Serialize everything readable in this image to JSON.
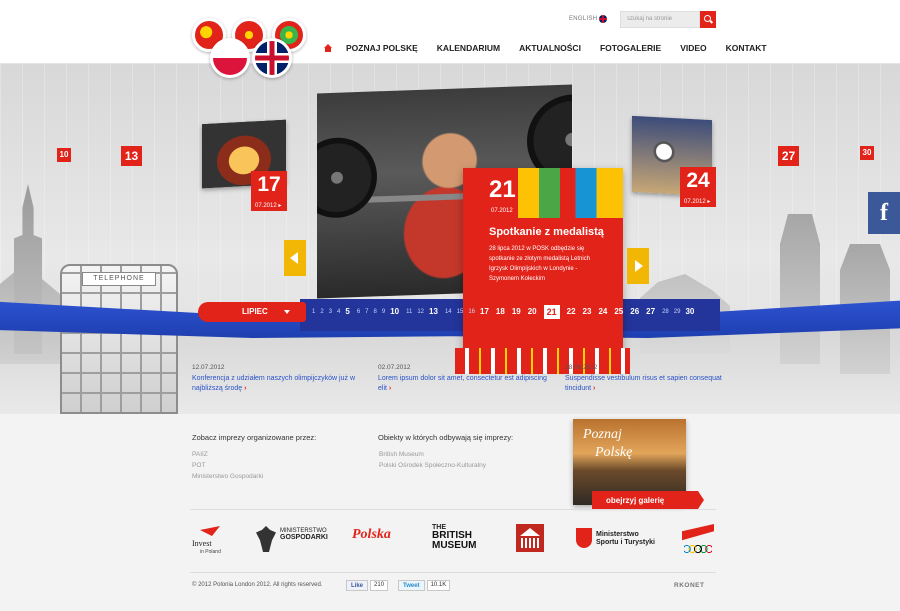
{
  "header": {
    "language_label": "ENGLISH",
    "search_placeholder": "szukaj na stronie",
    "nav": [
      "POZNAJ POLSKĘ",
      "KALENDARIUM",
      "AKTUALNOŚCI",
      "FOTOGALERIE",
      "VIDEO",
      "KONTAKT"
    ]
  },
  "hero": {
    "tiles": {
      "t10": "10",
      "t13": "13",
      "t27": "27",
      "t30": "30"
    },
    "left_card": {
      "day": "17",
      "date": "07.2012 ▸"
    },
    "right_card": {
      "day": "24",
      "date": "07.2012 ▸"
    },
    "phonebox_sign": "TELEPHONE",
    "featured": {
      "day": "21",
      "date": "07.2012",
      "title": "Spotkanie z medalistą",
      "description": "28 lipca 2012 w POSK odbędzie się spotkanie ze złotym medalistą Letnich Igrzysk Olimpijskich w Londynie - Szymonem Kołeckim"
    },
    "facebook_glyph": "f"
  },
  "calendar": {
    "month": "LIPIEC",
    "days": [
      {
        "n": "1",
        "ev": false
      },
      {
        "n": "2",
        "ev": false
      },
      {
        "n": "3",
        "ev": false
      },
      {
        "n": "4",
        "ev": false
      },
      {
        "n": "5",
        "ev": true
      },
      {
        "n": "6",
        "ev": false
      },
      {
        "n": "7",
        "ev": false
      },
      {
        "n": "8",
        "ev": false
      },
      {
        "n": "9",
        "ev": false
      },
      {
        "n": "10",
        "ev": true
      },
      {
        "n": "11",
        "ev": false
      },
      {
        "n": "12",
        "ev": false
      },
      {
        "n": "13",
        "ev": true
      },
      {
        "n": "14",
        "ev": false
      },
      {
        "n": "15",
        "ev": false
      },
      {
        "n": "16",
        "ev": false
      },
      {
        "n": "17",
        "ev": true
      },
      {
        "n": "18",
        "ev": true
      },
      {
        "n": "19",
        "ev": true
      },
      {
        "n": "20",
        "ev": true
      },
      {
        "n": "21",
        "ev": true,
        "sel": true
      },
      {
        "n": "22",
        "ev": true
      },
      {
        "n": "23",
        "ev": true
      },
      {
        "n": "24",
        "ev": true
      },
      {
        "n": "25",
        "ev": true
      },
      {
        "n": "26",
        "ev": true
      },
      {
        "n": "27",
        "ev": true
      },
      {
        "n": "28",
        "ev": false
      },
      {
        "n": "29",
        "ev": false
      },
      {
        "n": "30",
        "ev": true
      }
    ]
  },
  "news": [
    {
      "date": "12.07.2012",
      "title": "Konferencja z udziałem naszych olimpijczyków już w najbliższą środę"
    },
    {
      "date": "02.07.2012",
      "title": "Lorem ipsum dolor sit amet, consectetur est adipiscing elit"
    },
    {
      "date": "28.06.2012",
      "title": "Suspendisse vestibulum risus et sapien consequat tincidunt"
    }
  ],
  "organizers": {
    "title": "Zobacz imprezy organizowane przez:",
    "links": [
      "PAIIZ",
      "POT",
      "Ministerstwo Gospodarki"
    ]
  },
  "venues": {
    "title": "Obiekty w których odbywają się imprezy:",
    "links": [
      "British Museum",
      "Polski Ośrodek Społeczno-Kulturalny"
    ]
  },
  "gallery": {
    "line1": "Poznaj",
    "line2": "Polskę",
    "button": "obejrzyj galerię"
  },
  "partners": {
    "invest": {
      "line1": "Invest",
      "line2": "in Poland"
    },
    "mg": {
      "line1": "MINISTERSTWO",
      "line2": "GOSPODARKI"
    },
    "polska": "Polska",
    "bm": {
      "line1": "THE",
      "line2": "BRITISH MUSEUM"
    },
    "msit": {
      "line1": "Ministerstwo",
      "line2": "Sportu i Turystyki"
    }
  },
  "footer": {
    "copyright": "© 2012 Polonia London 2012. All rights reserved.",
    "like_label": "Like",
    "like_count": "210",
    "tweet_label": "Tweet",
    "tweet_count": "10.1K",
    "agency": "RKONET"
  },
  "colors": {
    "accent_red": "#e2231a",
    "ribbon_blue": "#2f56d6",
    "link_blue": "#2952c8",
    "arrow_yellow": "#f2b705",
    "facebook": "#3b5998"
  }
}
